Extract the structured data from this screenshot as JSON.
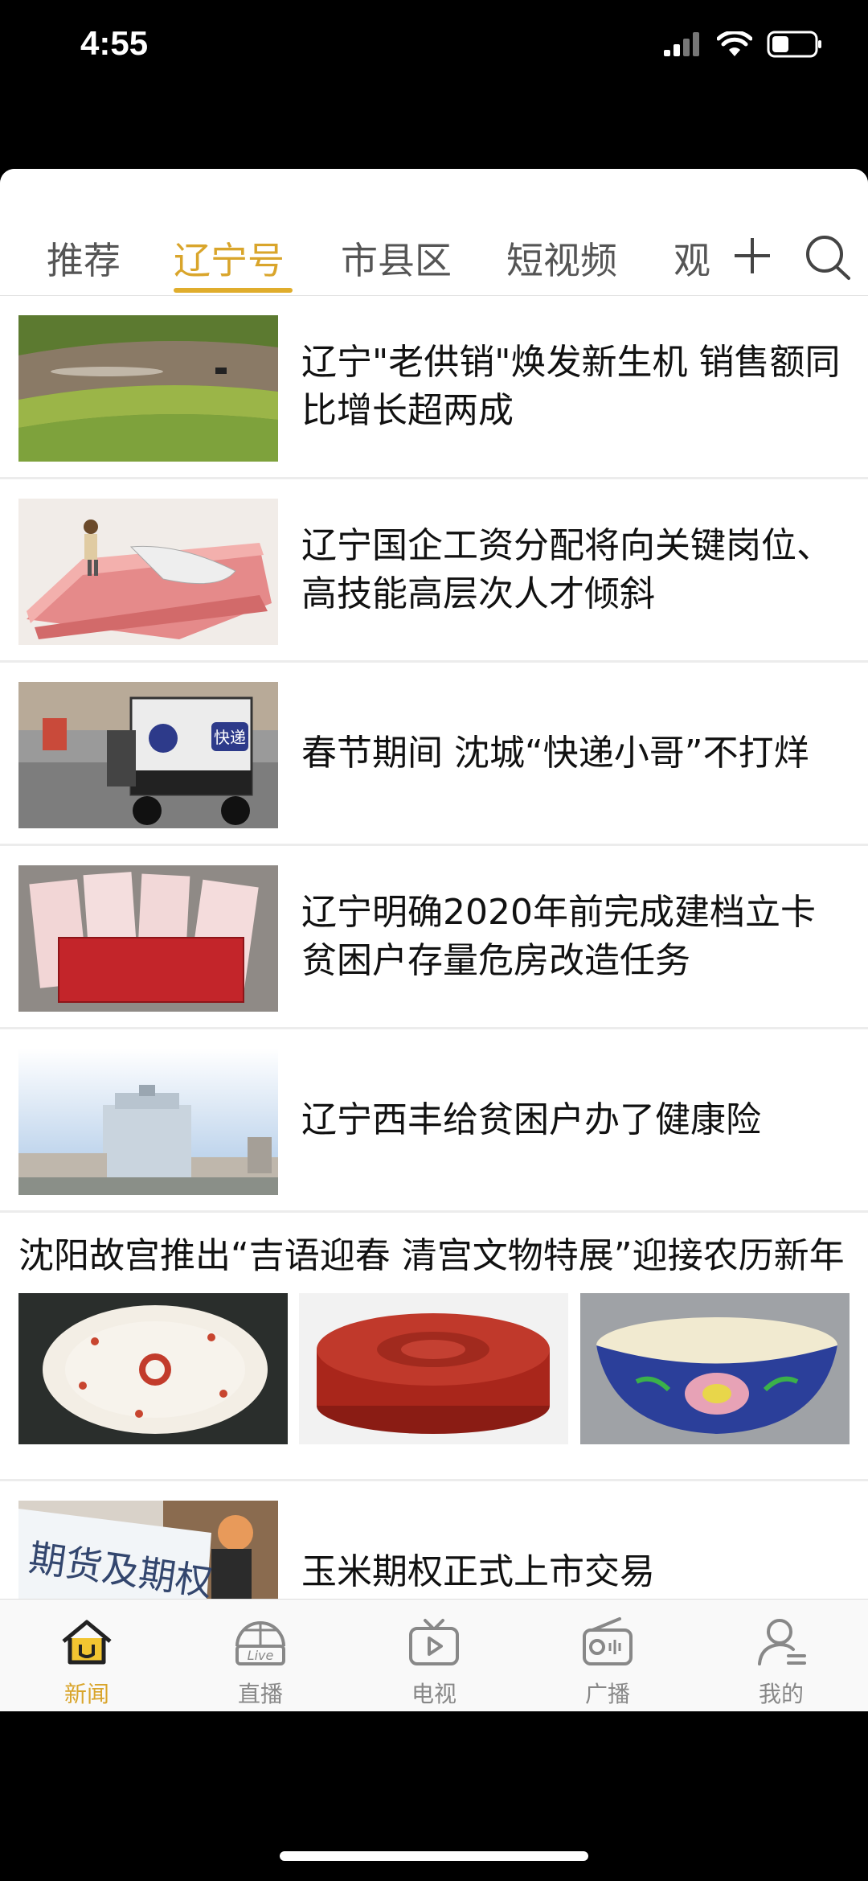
{
  "status_bar": {
    "time": "4:55"
  },
  "tabs": {
    "items": [
      {
        "label": "推荐",
        "active": false
      },
      {
        "label": "辽宁号",
        "active": true
      },
      {
        "label": "市县区",
        "active": false
      },
      {
        "label": "短视频",
        "active": false
      },
      {
        "label": "观",
        "active": false
      }
    ]
  },
  "feed": {
    "news": [
      {
        "title": "辽宁\"老供销\"焕发新生机 销售额同比增长超两成"
      },
      {
        "title": "辽宁国企工资分配将向关键岗位、高技能高层次人才倾斜"
      },
      {
        "title": "春节期间 沈城“快递小哥”不打烊"
      },
      {
        "title": "辽宁明确2020年前完成建档立卡贫困户存量危房改造任务"
      },
      {
        "title": "辽宁西丰给贫困户办了健康险"
      }
    ],
    "gallery": {
      "title": "沈阳故宫推出“吉语迎春 清宫文物特展”迎接农历新年"
    },
    "last": {
      "title": "玉米期权正式上市交易",
      "thumb_text": "期货及期权"
    },
    "courier_sign": "快递"
  },
  "bottom_nav": {
    "items": [
      {
        "label": "新闻",
        "active": true,
        "icon": "home-icon"
      },
      {
        "label": "直播",
        "active": false,
        "icon": "live-icon",
        "badge": "Live"
      },
      {
        "label": "电视",
        "active": false,
        "icon": "tv-icon"
      },
      {
        "label": "广播",
        "active": false,
        "icon": "radio-icon"
      },
      {
        "label": "我的",
        "active": false,
        "icon": "profile-icon"
      }
    ]
  },
  "colors": {
    "accent": "#d9a52b",
    "text": "#111111",
    "muted": "#888888"
  }
}
